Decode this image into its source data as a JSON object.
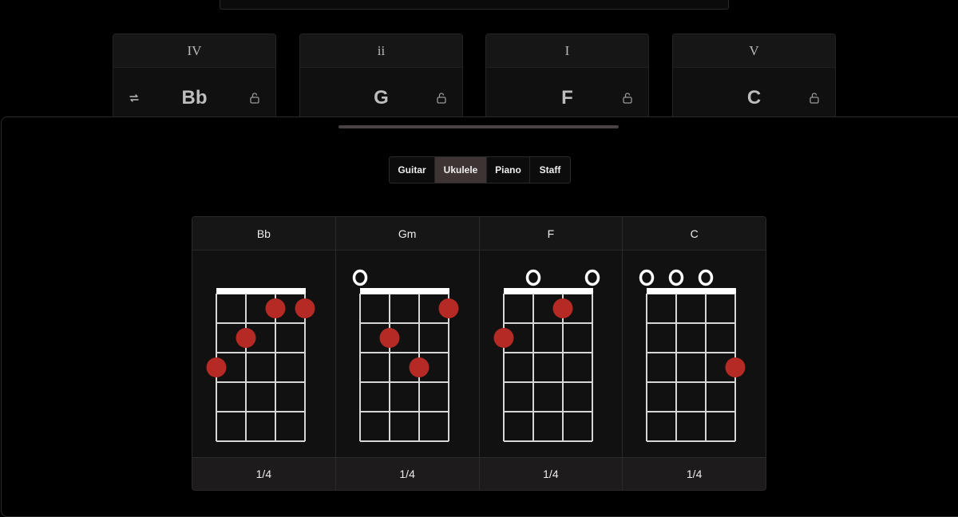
{
  "progression": [
    {
      "numeral": "IV",
      "chord": "Bb",
      "swap": true,
      "lock": "lock-open-icon"
    },
    {
      "numeral": "ii",
      "chord": "G",
      "swap": false,
      "lock": "lock-open-icon"
    },
    {
      "numeral": "I",
      "chord": "F",
      "swap": false,
      "lock": "lock-open-icon"
    },
    {
      "numeral": "V",
      "chord": "C",
      "swap": false,
      "lock": "lock-open-icon"
    }
  ],
  "instrument_tabs": {
    "selected": "Ukulele",
    "items": [
      "Guitar",
      "Ukulele",
      "Piano",
      "Staff"
    ]
  },
  "diagrams": [
    {
      "name": "Bb",
      "duration": "1/4",
      "strings": [
        3,
        2,
        1,
        1
      ]
    },
    {
      "name": "Gm",
      "duration": "1/4",
      "strings": [
        0,
        2,
        3,
        1
      ]
    },
    {
      "name": "F",
      "duration": "1/4",
      "strings": [
        2,
        0,
        1,
        0
      ]
    },
    {
      "name": "C",
      "duration": "1/4",
      "strings": [
        0,
        0,
        0,
        3
      ]
    }
  ],
  "colors": {
    "finger_dot": "#b52a25",
    "active_tab": "#3e3434",
    "fretboard_lines": "#d6d6d6"
  }
}
